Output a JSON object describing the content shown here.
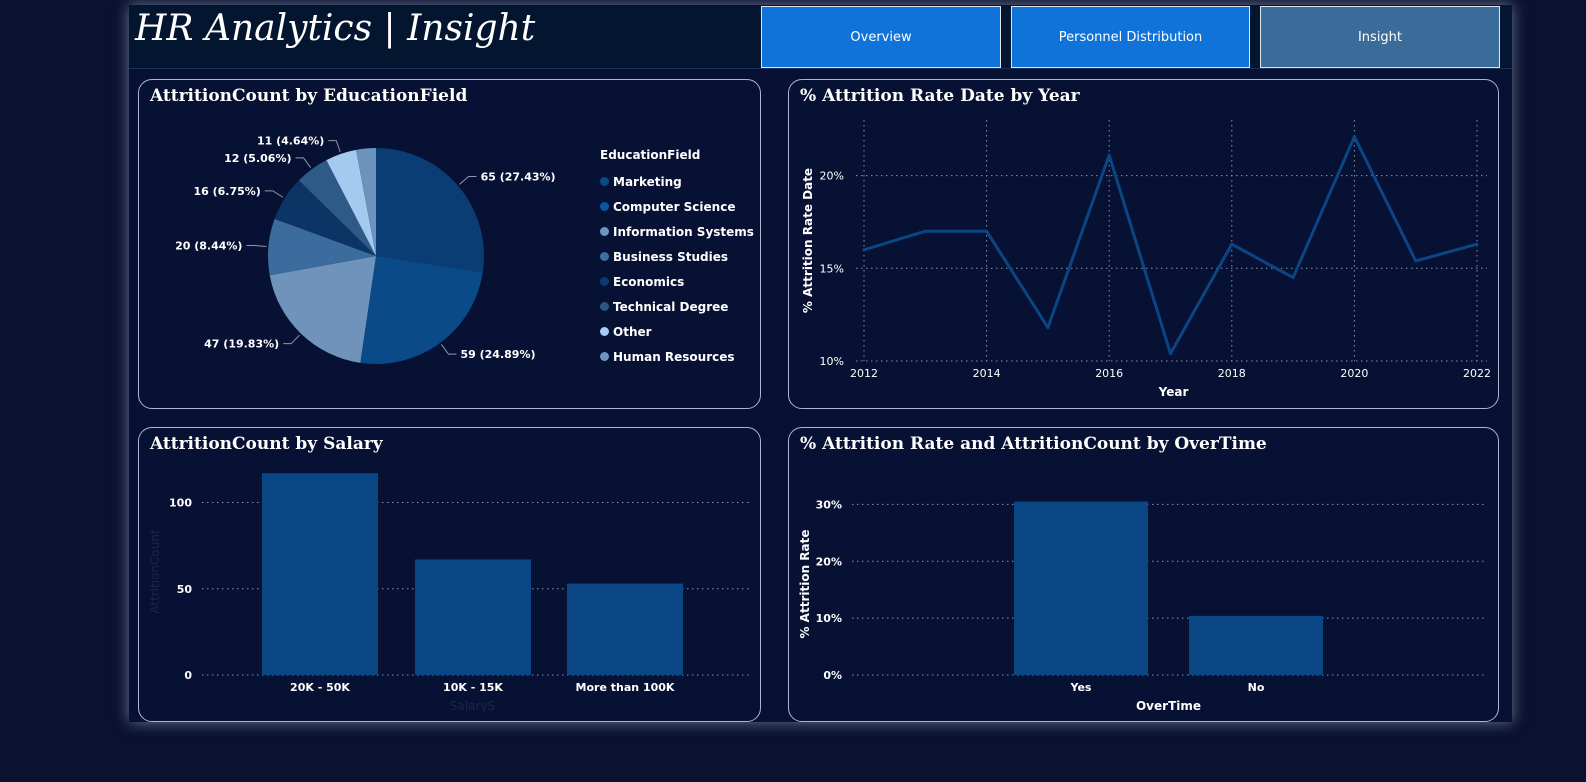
{
  "header": {
    "title": "HR Analytics | Insight",
    "nav": [
      {
        "label": "Overview",
        "color": "#0f73d9"
      },
      {
        "label": "Personnel Distribution",
        "color": "#0f73d9"
      },
      {
        "label": "Insight",
        "color": "#3b6b98"
      }
    ]
  },
  "chart_data": [
    {
      "type": "pie",
      "title": "AttritionCount by EducationField",
      "legend_title": "EducationField",
      "legend_position": "right",
      "categories": [
        "Marketing",
        "Computer Science",
        "Information Systems",
        "Business Studies",
        "Economics",
        "Technical Degree",
        "Other",
        "Human Resources"
      ],
      "legend_colors": [
        "#0a4a86",
        "#0b56a0",
        "#6f95bd",
        "#3f6fa2",
        "#0b3a70",
        "#2d5783",
        "#a7cdf2",
        "#6c97c2"
      ],
      "slices": [
        {
          "value": 65,
          "label": "65 (27.43%)",
          "color": "#0a3d73"
        },
        {
          "value": 59,
          "label": "59 (24.89%)",
          "color": "#0a4a88"
        },
        {
          "value": 47,
          "label": "47 (19.83%)",
          "color": "#6f93bb"
        },
        {
          "value": 20,
          "label": "20 (8.44%)",
          "color": "#3c6c9e"
        },
        {
          "value": 16,
          "label": "16 (6.75%)",
          "color": "#0c3566"
        },
        {
          "value": 12,
          "label": "12 (5.06%)",
          "color": "#2d5a86"
        },
        {
          "value": 11,
          "label": "11 (4.64%)",
          "color": "#a4cbef"
        },
        {
          "value": 7,
          "label": "",
          "color": "#6b93bc"
        }
      ]
    },
    {
      "type": "line",
      "title": "% Attrition Rate Date by Year",
      "xlabel": "Year",
      "ylabel": "% Attrition Rate Date",
      "x": [
        2012,
        2013,
        2014,
        2015,
        2016,
        2017,
        2018,
        2019,
        2020,
        2021,
        2022
      ],
      "values": [
        16.0,
        17.0,
        17.0,
        11.8,
        21.1,
        10.4,
        16.3,
        14.5,
        22.1,
        15.4,
        16.3
      ],
      "ylim": [
        10,
        23
      ],
      "yticks": [
        "10%",
        "15%",
        "20%"
      ],
      "ytick_values": [
        10,
        15,
        20
      ],
      "xticks": [
        "2012",
        "2014",
        "2016",
        "2018",
        "2020",
        "2022"
      ],
      "xtick_values": [
        2012,
        2014,
        2016,
        2018,
        2020,
        2022
      ],
      "color": "#0b4584",
      "grid": true
    },
    {
      "type": "bar",
      "title": "AttritionCount by Salary",
      "xlabel": "SalaryS",
      "ylabel": "AttritionCount",
      "categories": [
        "20K - 50K",
        "10K - 15K",
        "More than 100K"
      ],
      "values": [
        117,
        67,
        53
      ],
      "ylim": [
        0,
        120
      ],
      "yticks": [
        "0",
        "50",
        "100"
      ],
      "ytick_values": [
        0,
        50,
        100
      ],
      "color": "#0a4684",
      "grid": true
    },
    {
      "type": "bar",
      "title": "% Attrition Rate and AttritionCount by OverTime",
      "xlabel": "OverTime",
      "ylabel": "% Attrition Rate",
      "categories": [
        "Yes",
        "No"
      ],
      "values": [
        30.5,
        10.4
      ],
      "ylim": [
        0,
        32
      ],
      "yticks": [
        "0%",
        "10%",
        "20%",
        "30%"
      ],
      "ytick_values": [
        0,
        10,
        20,
        30
      ],
      "color": "#0a4684",
      "grid": true
    }
  ]
}
